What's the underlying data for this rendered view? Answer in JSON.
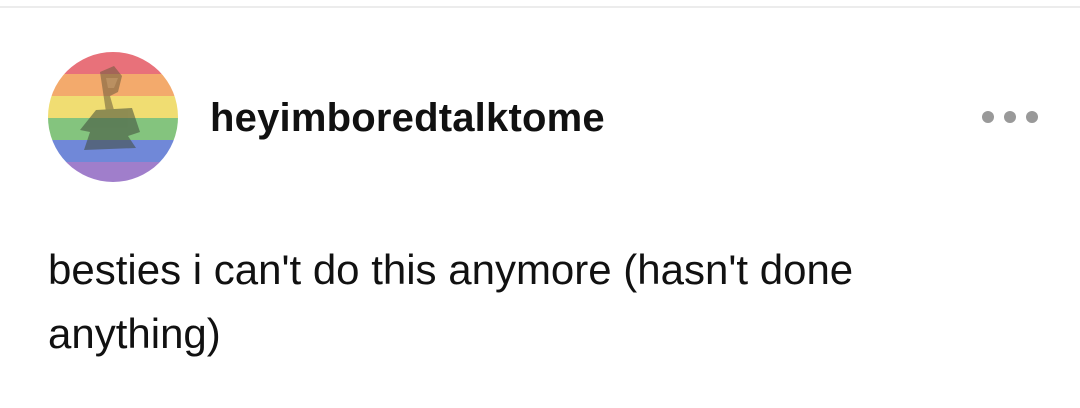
{
  "post": {
    "username": "heyimboredtalktome",
    "text": "besties i can't do this anymore (hasn't done anything)",
    "avatar_icon": "rainbow-flag-avatar",
    "more_icon": "more-options-icon"
  },
  "colors": {
    "text": "#111111",
    "menu_dots": "#999999",
    "divider": "#ececec",
    "avatar_stripes": [
      "#e76d6d",
      "#f2a76a",
      "#f1df6e",
      "#7ec47b",
      "#6f86d9",
      "#9b7ccc"
    ]
  }
}
